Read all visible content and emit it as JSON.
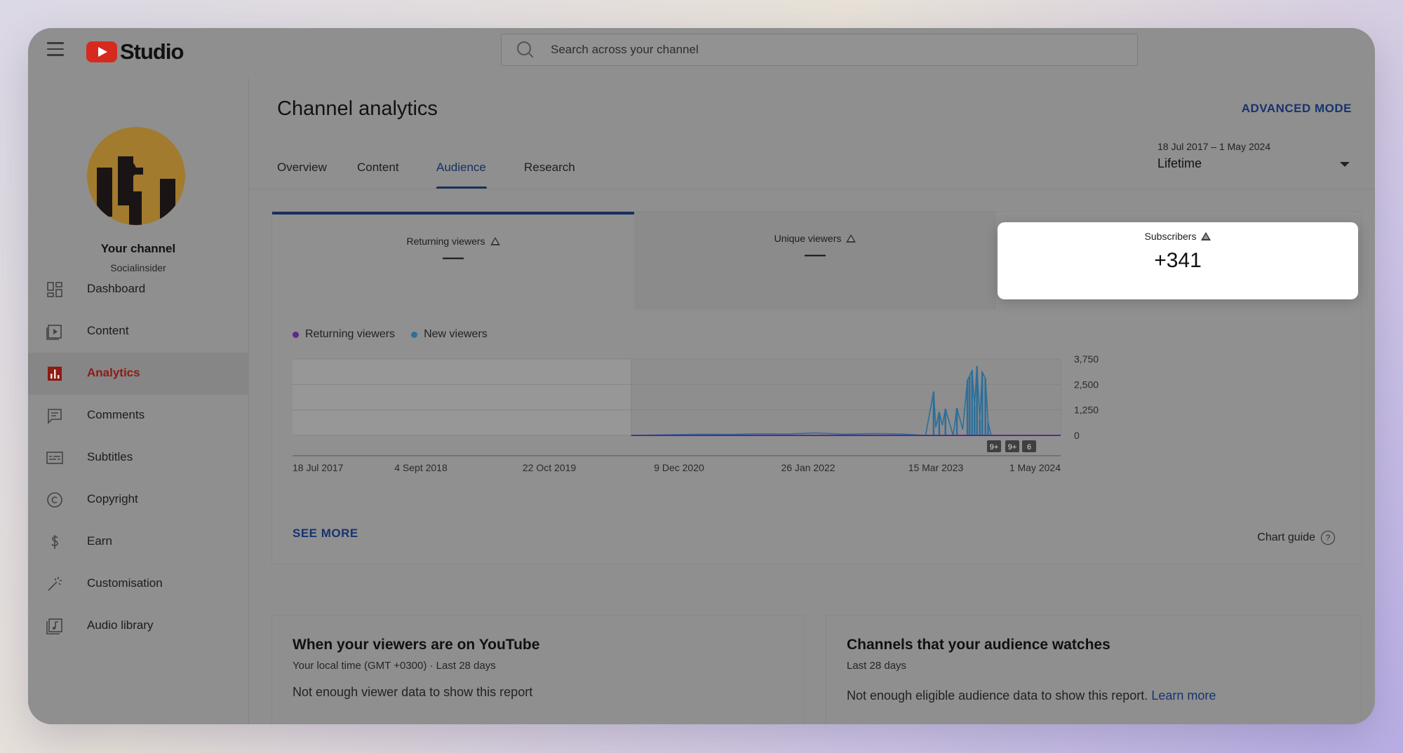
{
  "app": {
    "logo_text": "Studio",
    "search_placeholder": "Search across your channel"
  },
  "sidebar": {
    "channel_name": "Your channel",
    "channel_handle": "Socialinsider",
    "items": [
      {
        "label": "Dashboard",
        "icon": "dashboard-icon"
      },
      {
        "label": "Content",
        "icon": "content-icon"
      },
      {
        "label": "Analytics",
        "icon": "analytics-icon",
        "active": true
      },
      {
        "label": "Comments",
        "icon": "comments-icon"
      },
      {
        "label": "Subtitles",
        "icon": "subtitles-icon"
      },
      {
        "label": "Copyright",
        "icon": "copyright-icon"
      },
      {
        "label": "Earn",
        "icon": "earn-icon"
      },
      {
        "label": "Customisation",
        "icon": "customisation-icon"
      },
      {
        "label": "Audio library",
        "icon": "audio-library-icon"
      }
    ]
  },
  "main": {
    "title": "Channel analytics",
    "advanced_mode": "ADVANCED MODE",
    "tabs": [
      "Overview",
      "Content",
      "Audience",
      "Research"
    ],
    "active_tab": "Audience",
    "date": {
      "range": "18 Jul 2017 – 1 May 2024",
      "preset": "Lifetime"
    },
    "metrics": [
      {
        "title": "Returning viewers",
        "value": "—"
      },
      {
        "title": "Unique viewers",
        "value": "—"
      },
      {
        "title": "Subscribers",
        "value": "+341"
      }
    ],
    "legend": [
      {
        "name": "Returning viewers",
        "color": "#5b2a8a"
      },
      {
        "name": "New viewers",
        "color": "#2c6f9c"
      }
    ],
    "see_more": "SEE MORE",
    "chart_guide": "Chart guide",
    "chart_guide_icon": "?",
    "event_markers": [
      "9+",
      "9+",
      "6"
    ]
  },
  "chart_data": {
    "type": "line",
    "x_tick_labels": [
      "18 Jul 2017",
      "4 Sept 2018",
      "22 Oct 2019",
      "9 Dec 2020",
      "26 Jan 2022",
      "15 Mar 2023",
      "1 May 2024"
    ],
    "y_tick_labels": [
      "3,750",
      "2,500",
      "1,250",
      "0"
    ],
    "ylim": [
      0,
      3750
    ],
    "series": [
      {
        "name": "Returning viewers",
        "color": "#5b2a8a",
        "x": [
          "2020-07-15",
          "2024-05-01"
        ],
        "values": [
          0,
          0
        ]
      },
      {
        "name": "New viewers",
        "color": "#2c6f9c",
        "x": [
          "2020-07-15",
          "2021-03-01",
          "2021-06-01",
          "2021-09-01",
          "2021-12-01",
          "2022-03-01",
          "2022-06-01",
          "2022-09-01",
          "2022-12-01",
          "2023-02-20",
          "2023-03-18",
          "2023-03-25",
          "2023-04-05",
          "2023-04-15",
          "2023-04-25",
          "2023-05-20",
          "2023-06-01",
          "2023-06-20",
          "2023-07-05",
          "2023-07-12",
          "2023-07-20",
          "2023-07-28",
          "2023-08-05",
          "2023-08-14",
          "2023-08-22",
          "2023-09-01",
          "2023-09-10",
          "2023-09-20",
          "2023-10-01",
          "2023-10-12",
          "2024-01-10",
          "2024-05-01"
        ],
        "values": [
          0,
          60,
          50,
          80,
          70,
          120,
          60,
          90,
          70,
          0,
          2150,
          400,
          1150,
          500,
          1300,
          0,
          1350,
          300,
          2700,
          2900,
          3200,
          1500,
          3400,
          800,
          3100,
          2800,
          600,
          0,
          0,
          0,
          0,
          0
        ]
      }
    ],
    "shaded_region": [
      "2017-07-18",
      "2020-07-15"
    ],
    "grid": true,
    "legend_position": "top-left"
  },
  "bottom_cards": [
    {
      "title": "When your viewers are on YouTube",
      "subtitle": "Your local time (GMT +0300) · Last 28 days",
      "text": "Not enough viewer data to show this report"
    },
    {
      "title": "Channels that your audience watches",
      "subtitle": "Last 28 days",
      "text": "Not enough eligible audience data to show this report.",
      "link": "Learn more"
    }
  ]
}
